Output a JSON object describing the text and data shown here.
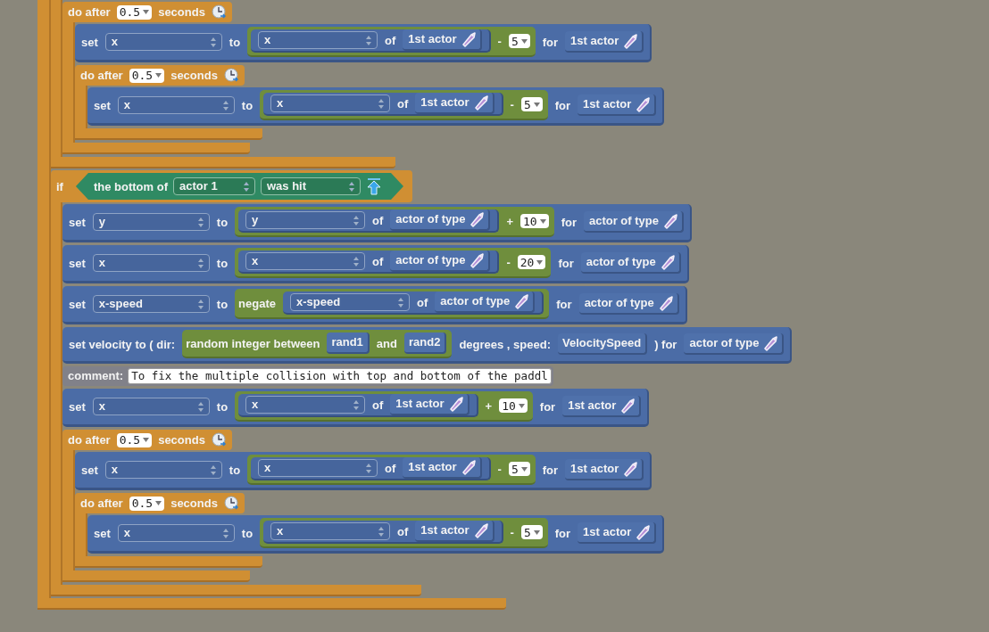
{
  "blocks": [
    {
      "kind": "frame",
      "children": [
        {
          "kind": "do_after",
          "tokens": [
            {
              "kind": "label",
              "text": "do after"
            },
            {
              "kind": "number",
              "text": "0.5"
            },
            {
              "kind": "label",
              "text": "seconds"
            },
            {
              "kind": "clock"
            }
          ],
          "children": [
            {
              "kind": "action",
              "tokens": [
                {
                  "kind": "label",
                  "text": "set"
                },
                {
                  "kind": "dropdown",
                  "text": "x"
                },
                {
                  "kind": "label",
                  "text": "to"
                },
                {
                  "kind": "expr",
                  "tokens": [
                    {
                      "kind": "reporter",
                      "tokens": [
                        {
                          "kind": "dropdown",
                          "text": "x"
                        },
                        {
                          "kind": "label",
                          "text": "of"
                        },
                        {
                          "kind": "actor",
                          "text": "1st actor"
                        }
                      ]
                    },
                    {
                      "kind": "label",
                      "text": "-"
                    },
                    {
                      "kind": "number",
                      "text": "5"
                    }
                  ]
                },
                {
                  "kind": "label",
                  "text": "for"
                },
                {
                  "kind": "actor",
                  "text": "1st actor"
                }
              ]
            },
            {
              "kind": "do_after",
              "tokens": [
                {
                  "kind": "label",
                  "text": "do after"
                },
                {
                  "kind": "number",
                  "text": "0.5"
                },
                {
                  "kind": "label",
                  "text": "seconds"
                },
                {
                  "kind": "clock"
                }
              ],
              "children": [
                {
                  "kind": "action",
                  "tokens": [
                    {
                      "kind": "label",
                      "text": "set"
                    },
                    {
                      "kind": "dropdown",
                      "text": "x"
                    },
                    {
                      "kind": "label",
                      "text": "to"
                    },
                    {
                      "kind": "expr",
                      "tokens": [
                        {
                          "kind": "reporter",
                          "tokens": [
                            {
                              "kind": "dropdown",
                              "text": "x"
                            },
                            {
                              "kind": "label",
                              "text": "of"
                            },
                            {
                              "kind": "actor",
                              "text": "1st actor"
                            }
                          ]
                        },
                        {
                          "kind": "label",
                          "text": "-"
                        },
                        {
                          "kind": "number",
                          "text": "5"
                        }
                      ]
                    },
                    {
                      "kind": "label",
                      "text": "for"
                    },
                    {
                      "kind": "actor",
                      "text": "1st actor"
                    }
                  ]
                }
              ]
            }
          ]
        }
      ]
    },
    {
      "kind": "if",
      "tokens": [
        {
          "kind": "label",
          "text": "if"
        },
        {
          "kind": "condition",
          "tokens": [
            {
              "kind": "label",
              "text": "the bottom of"
            },
            {
              "kind": "dropdown",
              "text": "actor 1"
            },
            {
              "kind": "dropdown",
              "text": "was hit"
            },
            {
              "kind": "arrow"
            }
          ]
        }
      ],
      "children": [
        {
          "kind": "action",
          "tokens": [
            {
              "kind": "label",
              "text": "set"
            },
            {
              "kind": "dropdown",
              "text": "y"
            },
            {
              "kind": "label",
              "text": "to"
            },
            {
              "kind": "expr",
              "tokens": [
                {
                  "kind": "reporter",
                  "tokens": [
                    {
                      "kind": "dropdown",
                      "text": "y"
                    },
                    {
                      "kind": "label",
                      "text": "of"
                    },
                    {
                      "kind": "actor",
                      "text": "actor of type"
                    }
                  ]
                },
                {
                  "kind": "label",
                  "text": "+"
                },
                {
                  "kind": "number",
                  "text": "10"
                }
              ]
            },
            {
              "kind": "label",
              "text": "for"
            },
            {
              "kind": "actor",
              "text": "actor of type"
            }
          ]
        },
        {
          "kind": "action",
          "tokens": [
            {
              "kind": "label",
              "text": "set"
            },
            {
              "kind": "dropdown",
              "text": "x"
            },
            {
              "kind": "label",
              "text": "to"
            },
            {
              "kind": "expr",
              "tokens": [
                {
                  "kind": "reporter",
                  "tokens": [
                    {
                      "kind": "dropdown",
                      "text": "x"
                    },
                    {
                      "kind": "label",
                      "text": "of"
                    },
                    {
                      "kind": "actor",
                      "text": "actor of type"
                    }
                  ]
                },
                {
                  "kind": "label",
                  "text": "-"
                },
                {
                  "kind": "number",
                  "text": "20"
                }
              ]
            },
            {
              "kind": "label",
              "text": "for"
            },
            {
              "kind": "actor",
              "text": "actor of type"
            }
          ]
        },
        {
          "kind": "action",
          "tokens": [
            {
              "kind": "label",
              "text": "set"
            },
            {
              "kind": "dropdown",
              "text": "x-speed"
            },
            {
              "kind": "label",
              "text": "to"
            },
            {
              "kind": "expr",
              "tokens": [
                {
                  "kind": "label",
                  "text": "negate"
                },
                {
                  "kind": "reporter",
                  "tokens": [
                    {
                      "kind": "dropdown",
                      "text": "x-speed"
                    },
                    {
                      "kind": "label",
                      "text": "of"
                    },
                    {
                      "kind": "actor",
                      "text": "actor of type"
                    }
                  ]
                }
              ]
            },
            {
              "kind": "label",
              "text": "for"
            },
            {
              "kind": "actor",
              "text": "actor of type"
            }
          ]
        },
        {
          "kind": "action",
          "tokens": [
            {
              "kind": "label",
              "text": "set velocity to ( dir:"
            },
            {
              "kind": "expr",
              "tokens": [
                {
                  "kind": "label",
                  "text": "random integer between"
                },
                {
                  "kind": "chip",
                  "text": "rand1"
                },
                {
                  "kind": "label",
                  "text": "and"
                },
                {
                  "kind": "chip",
                  "text": "rand2"
                }
              ]
            },
            {
              "kind": "label",
              "text": "degrees , speed:"
            },
            {
              "kind": "chip",
              "text": "VelocitySpeed"
            },
            {
              "kind": "label",
              "text": ") for"
            },
            {
              "kind": "actor",
              "text": "actor of type"
            }
          ]
        },
        {
          "kind": "comment",
          "label": "comment:",
          "text": "To fix the multiple collision with top and bottom of the paddl"
        },
        {
          "kind": "action",
          "tokens": [
            {
              "kind": "label",
              "text": "set"
            },
            {
              "kind": "dropdown",
              "text": "x"
            },
            {
              "kind": "label",
              "text": "to"
            },
            {
              "kind": "expr",
              "tokens": [
                {
                  "kind": "reporter",
                  "tokens": [
                    {
                      "kind": "dropdown",
                      "text": "x"
                    },
                    {
                      "kind": "label",
                      "text": "of"
                    },
                    {
                      "kind": "actor",
                      "text": "1st actor"
                    }
                  ]
                },
                {
                  "kind": "label",
                  "text": "+"
                },
                {
                  "kind": "number",
                  "text": "10"
                }
              ]
            },
            {
              "kind": "label",
              "text": "for"
            },
            {
              "kind": "actor",
              "text": "1st actor"
            }
          ]
        },
        {
          "kind": "do_after",
          "tokens": [
            {
              "kind": "label",
              "text": "do after"
            },
            {
              "kind": "number",
              "text": "0.5"
            },
            {
              "kind": "label",
              "text": "seconds"
            },
            {
              "kind": "clock"
            }
          ],
          "children": [
            {
              "kind": "action",
              "tokens": [
                {
                  "kind": "label",
                  "text": "set"
                },
                {
                  "kind": "dropdown",
                  "text": "x"
                },
                {
                  "kind": "label",
                  "text": "to"
                },
                {
                  "kind": "expr",
                  "tokens": [
                    {
                      "kind": "reporter",
                      "tokens": [
                        {
                          "kind": "dropdown",
                          "text": "x"
                        },
                        {
                          "kind": "label",
                          "text": "of"
                        },
                        {
                          "kind": "actor",
                          "text": "1st actor"
                        }
                      ]
                    },
                    {
                      "kind": "label",
                      "text": "-"
                    },
                    {
                      "kind": "number",
                      "text": "5"
                    }
                  ]
                },
                {
                  "kind": "label",
                  "text": "for"
                },
                {
                  "kind": "actor",
                  "text": "1st actor"
                }
              ]
            },
            {
              "kind": "do_after",
              "tokens": [
                {
                  "kind": "label",
                  "text": "do after"
                },
                {
                  "kind": "number",
                  "text": "0.5"
                },
                {
                  "kind": "label",
                  "text": "seconds"
                },
                {
                  "kind": "clock"
                }
              ],
              "children": [
                {
                  "kind": "action",
                  "tokens": [
                    {
                      "kind": "label",
                      "text": "set"
                    },
                    {
                      "kind": "dropdown",
                      "text": "x"
                    },
                    {
                      "kind": "label",
                      "text": "to"
                    },
                    {
                      "kind": "expr",
                      "tokens": [
                        {
                          "kind": "reporter",
                          "tokens": [
                            {
                              "kind": "dropdown",
                              "text": "x"
                            },
                            {
                              "kind": "label",
                              "text": "of"
                            },
                            {
                              "kind": "actor",
                              "text": "1st actor"
                            }
                          ]
                        },
                        {
                          "kind": "label",
                          "text": "-"
                        },
                        {
                          "kind": "number",
                          "text": "5"
                        }
                      ]
                    },
                    {
                      "kind": "label",
                      "text": "for"
                    },
                    {
                      "kind": "actor",
                      "text": "1st actor"
                    }
                  ]
                }
              ]
            }
          ]
        }
      ]
    }
  ]
}
